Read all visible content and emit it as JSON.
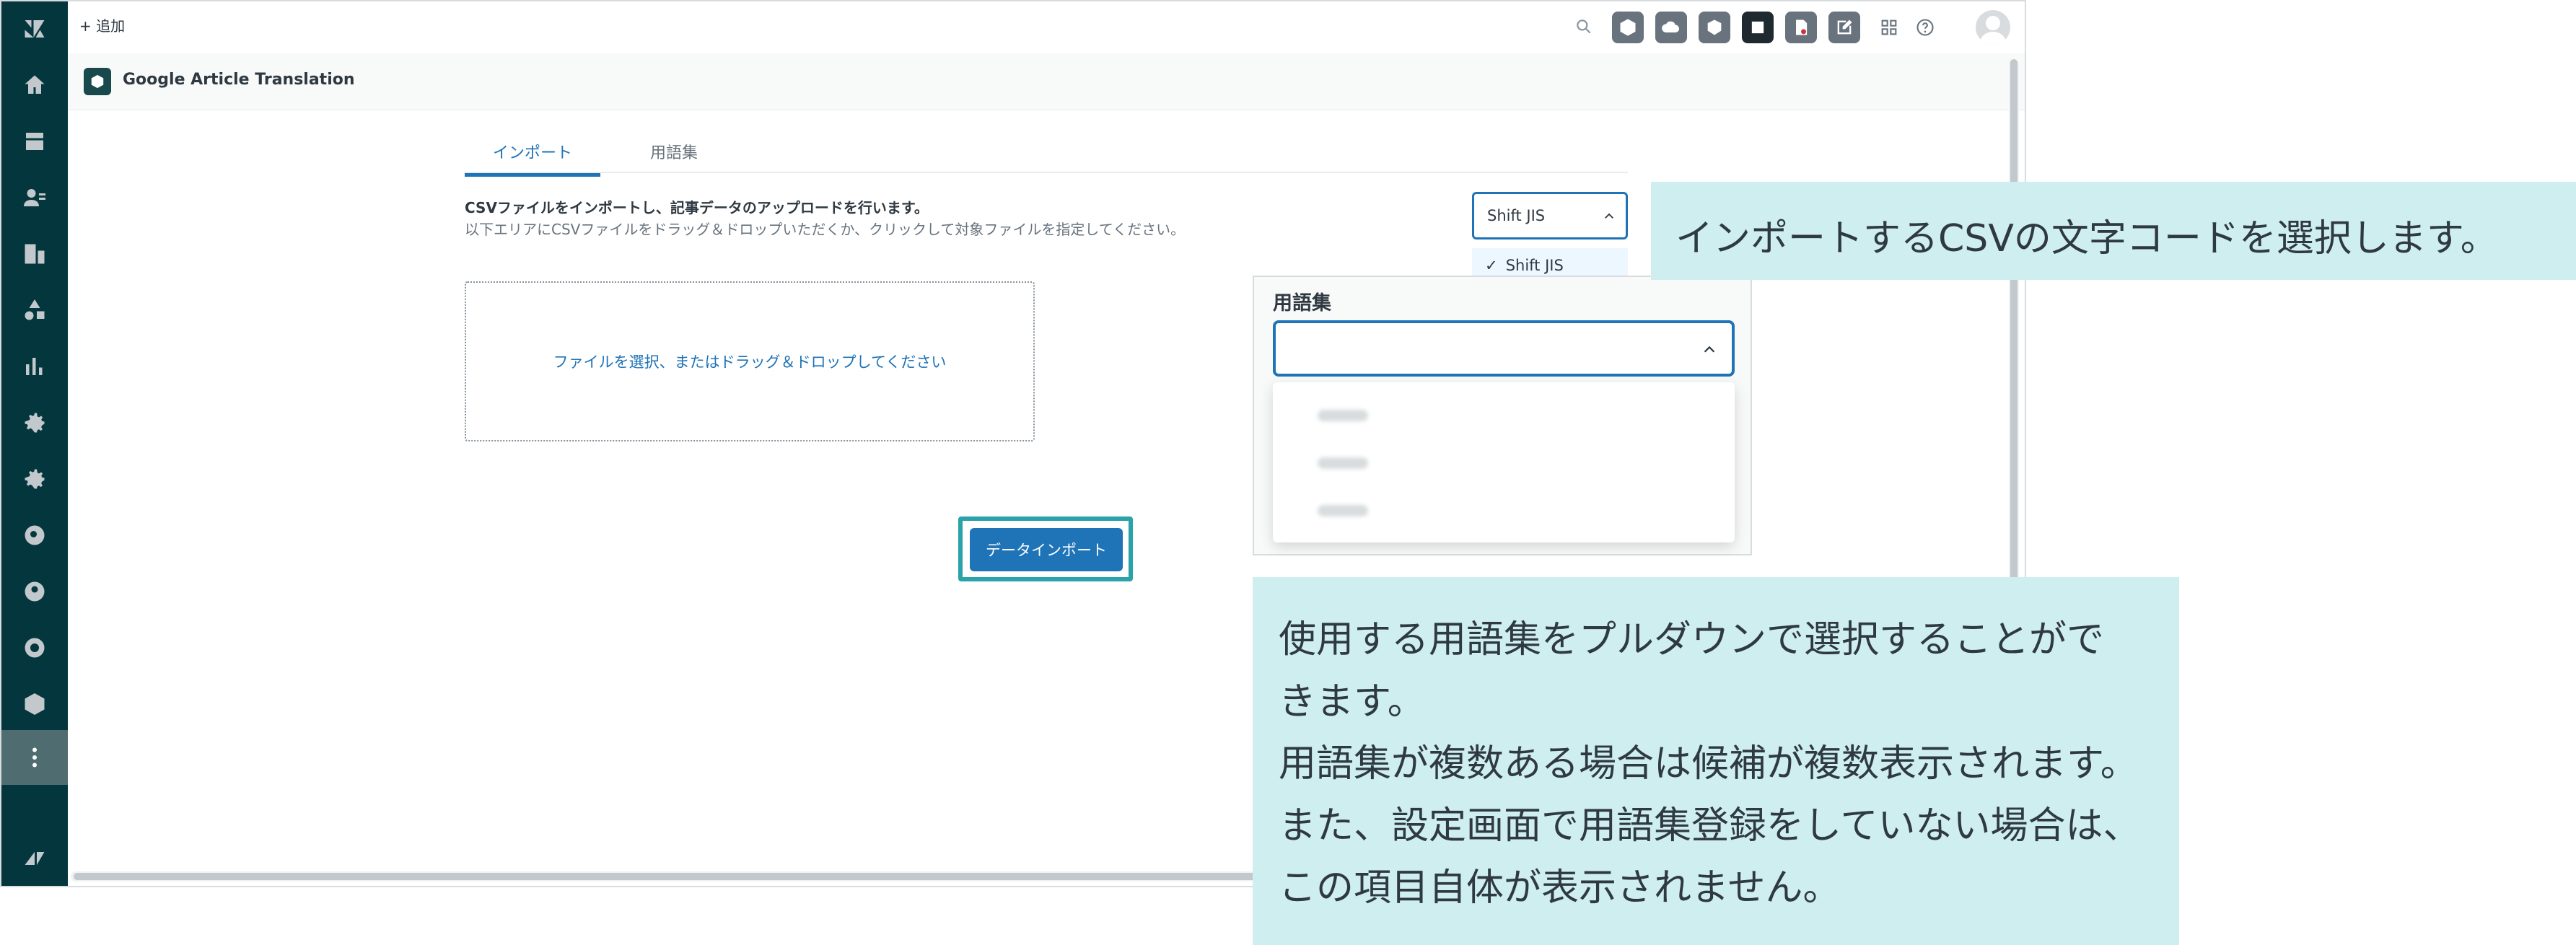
{
  "topbar": {
    "add_label": "+ 追加"
  },
  "app_header": {
    "title": "Google Article Translation"
  },
  "tabs": [
    {
      "label": "インポート",
      "active": true
    },
    {
      "label": "用語集",
      "active": false
    }
  ],
  "import": {
    "description_title": "CSVファイルをインポートし、記事データのアップロードを行います。",
    "description_body": "以下エリアにCSVファイルをドラッグ＆ドロップいただくか、クリックして対象ファイルを指定してください。",
    "dropzone_text": "ファイルを選択、またはドラッグ＆ドロップしてください",
    "import_button_label": "データインポート"
  },
  "encoding": {
    "selected": "Shift JIS",
    "options": [
      {
        "label": "Shift JIS",
        "checked": true
      }
    ]
  },
  "glossary": {
    "label": "用語集",
    "value": ""
  },
  "callouts": {
    "encoding_note": "インポートするCSVの文字コードを選択します。",
    "glossary_note_lines": [
      "使用する用語集をプルダウンで選択することがで",
      "きます。",
      "用語集が複数ある場合は候補が複数表示されます。",
      "また、設定画面で用語集登録をしていない場合は、",
      "この項目自体が表示されません。"
    ]
  },
  "colors": {
    "sidebar": "#03363d",
    "accent": "#1f73b7",
    "highlight_border": "#2aa2a9",
    "callout_bg": "#cfeef0"
  }
}
